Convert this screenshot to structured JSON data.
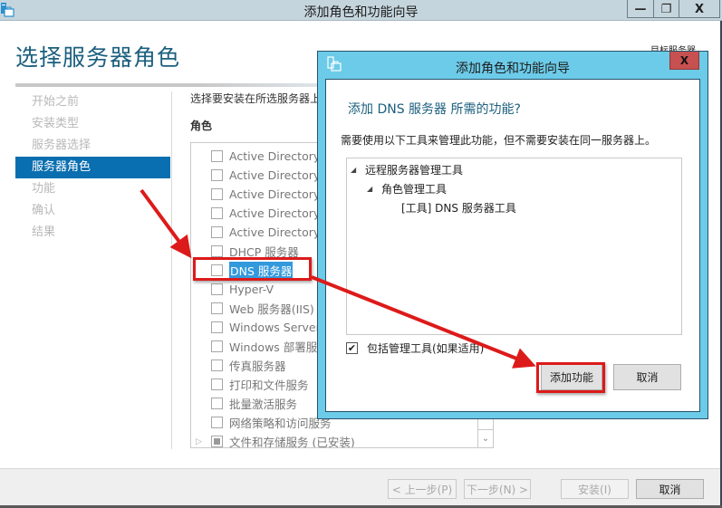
{
  "window": {
    "title": "添加角色和功能向导",
    "app_icon": "server-manager-icon",
    "controls": {
      "minimize": "—",
      "restore": "❐",
      "close": "X"
    }
  },
  "page": {
    "title": "选择服务器角色",
    "target_server_label": "目标服务器"
  },
  "nav": {
    "items": [
      {
        "label": "开始之前",
        "active": false
      },
      {
        "label": "安装类型",
        "active": false
      },
      {
        "label": "服务器选择",
        "active": false
      },
      {
        "label": "服务器角色",
        "active": true
      },
      {
        "label": "功能",
        "active": false
      },
      {
        "label": "确认",
        "active": false
      },
      {
        "label": "结果",
        "active": false
      }
    ]
  },
  "roles": {
    "description": "选择要安装在所选服务器上",
    "header": "角色",
    "items": [
      {
        "label": "Active Directory",
        "checked": false
      },
      {
        "label": "Active Directory",
        "checked": false
      },
      {
        "label": "Active Directory",
        "checked": false
      },
      {
        "label": "Active Directory",
        "checked": false
      },
      {
        "label": "Active Directory",
        "checked": false
      },
      {
        "label": "DHCP 服务器",
        "checked": false
      },
      {
        "label": "DNS 服务器",
        "checked": false,
        "selected": true
      },
      {
        "label": "Hyper-V",
        "checked": false
      },
      {
        "label": "Web 服务器(IIS)",
        "checked": false
      },
      {
        "label": "Windows Server",
        "checked": false
      },
      {
        "label": "Windows 部署服务",
        "checked": false
      },
      {
        "label": "传真服务器",
        "checked": false
      },
      {
        "label": "打印和文件服务",
        "checked": false
      },
      {
        "label": "批量激活服务",
        "checked": false
      },
      {
        "label": "网络策略和访问服务",
        "checked": false
      },
      {
        "label": "文件和存储服务 (已安装)",
        "checked": "partial",
        "expandable": true
      }
    ],
    "scroll_down_glyph": "⌄"
  },
  "footer": {
    "prev_label": "< 上一步(P)",
    "next_label": "下一步(N) >",
    "install_label": "安装(I)",
    "cancel_label": "取消"
  },
  "dialog": {
    "title": "添加角色和功能向导",
    "close_label": "X",
    "question": "添加 DNS 服务器 所需的功能?",
    "description": "需要使用以下工具来管理此功能，但不需要安装在同一服务器上。",
    "tree": [
      {
        "label": "远程服务器管理工具",
        "level": 0,
        "expanded": true
      },
      {
        "label": "角色管理工具",
        "level": 1,
        "expanded": true
      },
      {
        "label": "[工具] DNS 服务器工具",
        "level": 2,
        "expanded": null
      }
    ],
    "include_tools_label": "包括管理工具(如果适用)",
    "include_tools_checked": true,
    "add_features_label": "添加功能",
    "cancel_label": "取消"
  },
  "annotations": {
    "highlight_color": "#dd1a1a"
  },
  "colors": {
    "title_blue": "#1b5f7e",
    "nav_active": "#0a6fb0",
    "dialog_frame": "#6ccbe8",
    "close_red": "#c75050",
    "selection_blue": "#3399dd"
  }
}
